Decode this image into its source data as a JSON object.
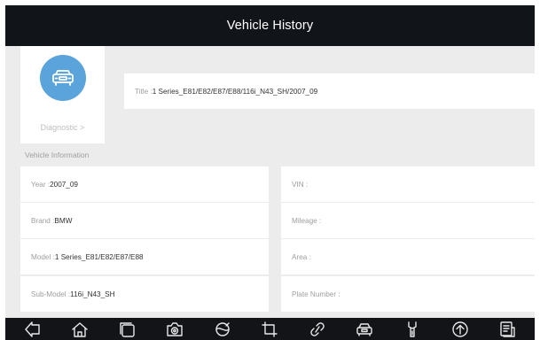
{
  "header": {
    "title": "Vehicle History"
  },
  "diagnostic": {
    "label": "Diagnostic >",
    "icon": "car-icon",
    "accent": "#5aa4db"
  },
  "title_record": {
    "label": "Title : ",
    "value": "1 Series_E81/E82/E87/E88/116i_N43_SH/2007_09"
  },
  "vehicle_info": {
    "section_label": "Vehicle Information",
    "left": [
      {
        "label": "Year : ",
        "value": "2007_09"
      },
      {
        "label": "Brand : ",
        "value": "BMW"
      },
      {
        "label": "Model : ",
        "value": "1 Series_E81/E82/E87/E88"
      },
      {
        "label": "Sub-Model : ",
        "value": "116i_N43_SH"
      }
    ],
    "right": [
      {
        "label": "VIN : ",
        "value": ""
      },
      {
        "label": "Mileage : ",
        "value": ""
      },
      {
        "label": "Area : ",
        "value": ""
      },
      {
        "label": "Plate Number : ",
        "value": ""
      }
    ]
  },
  "navbar": {
    "icons": [
      "back-icon",
      "home-icon",
      "recent-apps-icon",
      "camera-icon",
      "browser-icon",
      "crop-icon",
      "link-icon",
      "vehicle-icon",
      "tools-icon",
      "upload-icon",
      "report-icon"
    ]
  },
  "colors": {
    "header_bg": "#111418",
    "page_bg": "#ececec",
    "navbar_bg": "#121418"
  }
}
